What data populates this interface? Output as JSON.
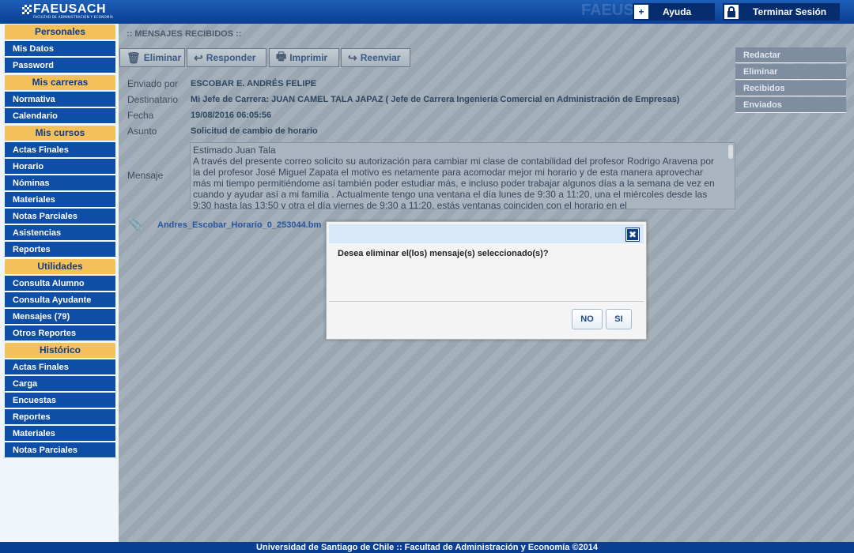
{
  "brand": {
    "name": "FAEUSACH",
    "subtitle": "FACULTAD DE ADMINISTRACIÓN Y ECONOMÍA",
    "watermark": "FAEUSACH"
  },
  "topbar": {
    "help_label": "Ayuda",
    "logout_label": "Terminar Sesión"
  },
  "sidebar": {
    "sections": [
      {
        "title": "Personales",
        "items": [
          "Mis Datos",
          "Password"
        ]
      },
      {
        "title": "Mis carreras",
        "items": [
          "Normativa",
          "Calendario"
        ]
      },
      {
        "title": "Mis cursos",
        "items": [
          "Actas Finales",
          "Horario",
          "Nóminas",
          "Materiales",
          "Notas Parciales",
          "Asistencias",
          "Reportes"
        ]
      },
      {
        "title": "Utilidades",
        "items": [
          "Consulta Alumno",
          "Consulta Ayudante",
          "Mensajes (79)",
          "Otros Reportes"
        ]
      },
      {
        "title": "Histórico",
        "items": [
          "Actas Finales",
          "Carga",
          "Encuestas",
          "Reportes",
          "Materiales",
          "Notas Parciales"
        ]
      }
    ]
  },
  "main": {
    "breadcrumb": ":: MENSAJES RECIBIDOS ::",
    "toolbar": {
      "delete": "Eliminar",
      "reply": "Responder",
      "print": "Imprimir",
      "forward": "Reenviar"
    },
    "message": {
      "from_label": "Enviado por",
      "from": "ESCOBAR E. ANDRÉS FELIPE",
      "to_label": "Destinatario",
      "to": "Mi Jefe de Carrera: JUAN CAMEL TALA JAPAZ ( Jefe de Carrera Ingeniería Comercial en Administración de Empresas)",
      "date_label": "Fecha",
      "date": "19/08/2016 06:05:56",
      "subject_label": "Asunto",
      "subject": "Solicitud de cambio de horario",
      "body_label": "Mensaje",
      "body": "Estimado Juan Tala\nA través del presente correo solicito su autorización para cambiar mi clase de contabilidad del profesor Rodrigo Aravena por la del profesor José Miguel Zapata el motivo es netamente para acomodar mejor mi horario y de esta manera aprovechar más mi tiempo permitiéndome así también poder estudiar más, e incluso poder trabajar algunos días a la semana de vez en cuando y ayudar así a mi familia . Actualmente tengo una ventana el día lunes de 9:30 a 11:20, una el miércoles desde las 9:30 hasta las 13:50 y otra el día viernes de 9:30 a 11:20, estás ventanas coinciden con el horario en el",
      "attachment": "Andres_Escobar_Horario_0_253044.bm"
    },
    "right_menu": [
      "Redactar",
      "Eliminar",
      "Recibidos",
      "Enviados"
    ]
  },
  "dialog": {
    "message": "Desea eliminar el(los) mensaje(s) seleccionado(s)?",
    "no_label": "NO",
    "yes_label": "SI"
  },
  "footer": {
    "text": "Universidad de Santiago de Chile :: Facultad de Administración y Economía ©2014"
  }
}
